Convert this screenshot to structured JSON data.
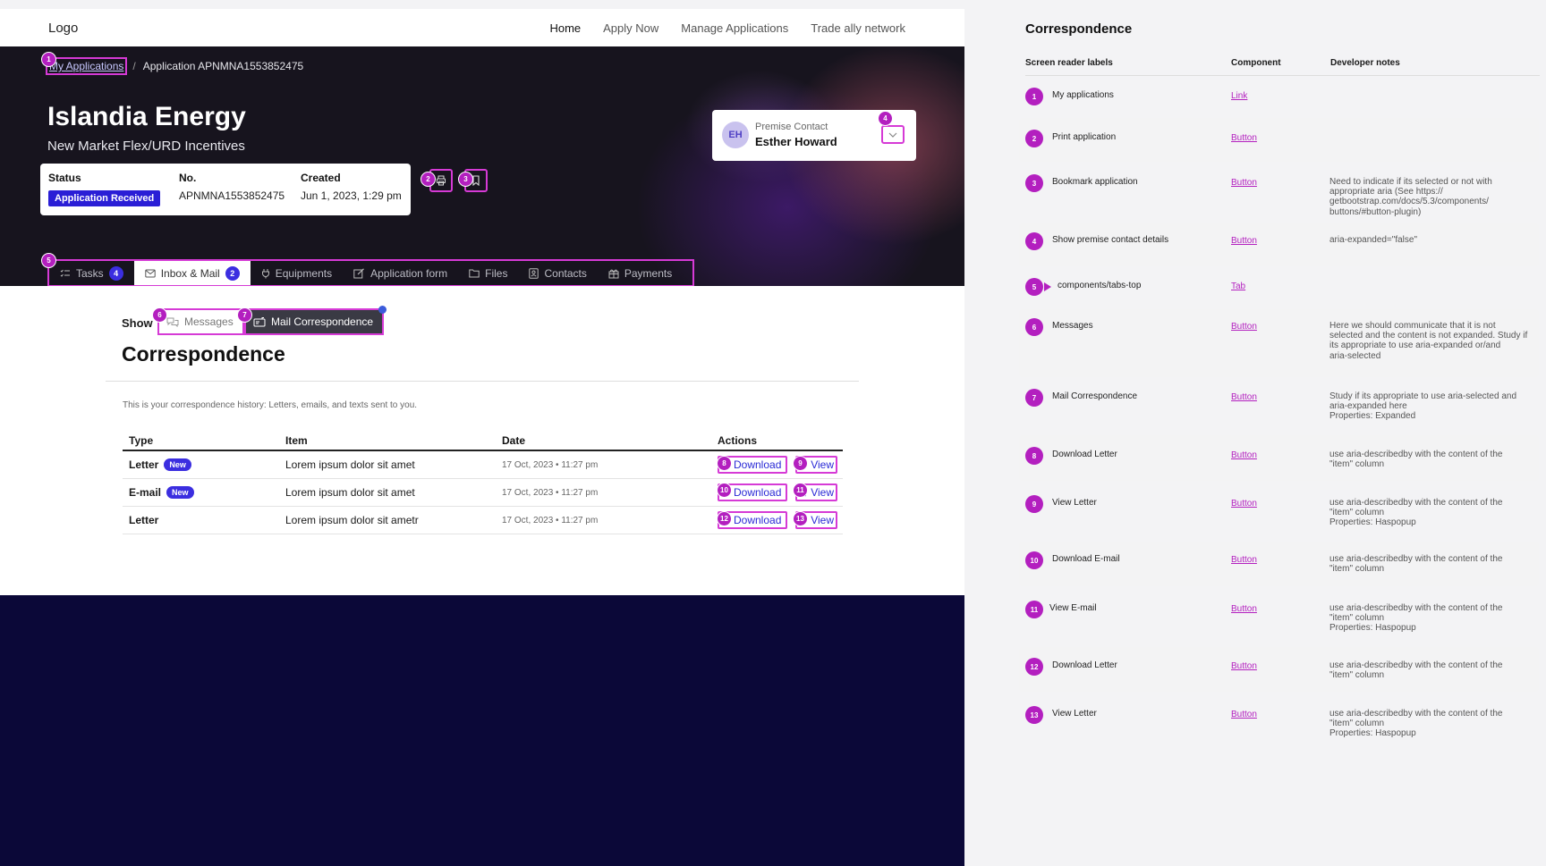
{
  "nav": {
    "logo": "Logo",
    "links": [
      "Home",
      "Apply Now",
      "Manage Applications",
      "Trade ally network"
    ]
  },
  "breadcrumb": {
    "link": "My Applications",
    "separator": "/",
    "current": "Application APNMNA1553852475"
  },
  "hero": {
    "title": "Islandia Energy",
    "subtitle": "New Market Flex/URD Incentives"
  },
  "status_card": {
    "status_label": "Status",
    "status_value": "Application Received",
    "no_label": "No.",
    "no_value": "APNMNA1553852475",
    "created_label": "Created",
    "created_value": "Jun 1, 2023, 1:29 pm"
  },
  "contact": {
    "initials": "EH",
    "label": "Premise Contact",
    "name": "Esther Howard"
  },
  "tabs": [
    {
      "label": "Tasks",
      "count": "4"
    },
    {
      "label": "Inbox & Mail",
      "count": "2"
    },
    {
      "label": "Equipments"
    },
    {
      "label": "Application form"
    },
    {
      "label": "Files"
    },
    {
      "label": "Contacts"
    },
    {
      "label": "Payments"
    }
  ],
  "content": {
    "show_label": "Show",
    "toggle_messages": "Messages",
    "toggle_mail": "Mail Correspondence",
    "title": "Correspondence",
    "description": "This is your correspondence history: Letters, emails, and texts sent to you.",
    "table": {
      "headers": [
        "Type",
        "Item",
        "Date",
        "Actions"
      ],
      "rows": [
        {
          "type": "Letter",
          "badge": "New",
          "item": "Lorem ipsum dolor sit amet",
          "date": "17 Oct, 2023 • 11:27 pm",
          "download": "Download",
          "view": "View"
        },
        {
          "type": "E-mail",
          "badge": "New",
          "item": "Lorem ipsum dolor sit amet",
          "date": "17 Oct, 2023 • 11:27 pm",
          "download": "Download",
          "view": "View"
        },
        {
          "type": "Letter",
          "item": "Lorem ipsum dolor sit ametr",
          "date": "17 Oct, 2023 • 11:27 pm",
          "download": "Download",
          "view": "View"
        }
      ]
    }
  },
  "markers": [
    "1",
    "2",
    "3",
    "4",
    "5",
    "6",
    "7",
    "8",
    "9",
    "10",
    "11",
    "12",
    "13"
  ],
  "panel": {
    "title": "Correspondence",
    "headers": [
      "Screen reader labels",
      "Component",
      "Developer notes"
    ],
    "rows": [
      {
        "n": "1",
        "label": "My applications",
        "component": "Link",
        "note": ""
      },
      {
        "n": "2",
        "label": "Print application",
        "component": "Button",
        "note": ""
      },
      {
        "n": "3",
        "label": "Bookmark application",
        "component": "Button",
        "note": "Need to indicate if its selected or not with\n appropriate aria (See https://\ngetbootstrap.com/docs/5.3/components/\nbuttons/#button-plugin)"
      },
      {
        "n": "4",
        "label": "Show premise contact details",
        "component": "Button",
        "note": "aria-expanded=\"false\""
      },
      {
        "n": "5",
        "label": "components/tabs-top",
        "component": "Tab",
        "note": ""
      },
      {
        "n": "6",
        "label": "Messages",
        "component": "Button",
        "note": "Here we should communicate that it is not\nselected and the content is not expanded. Study if\nits appropriate to use aria-expanded or/and\naria-selected"
      },
      {
        "n": "7",
        "label": "Mail Correspondence",
        "component": "Button",
        "note": "Study if its appropriate to use aria-selected and\naria-expanded here\nProperties: Expanded"
      },
      {
        "n": "8",
        "label": "Download Letter",
        "component": "Button",
        "note": "use aria-describedby with the content of the\n\"item\" column"
      },
      {
        "n": "9",
        "label": "View Letter",
        "component": "Button",
        "note": "use aria-describedby with the content of the\n\"item\" column\nProperties: Haspopup"
      },
      {
        "n": "10",
        "label": "Download E-mail",
        "component": "Button",
        "note": "use aria-describedby with the content of the\n\"item\" column"
      },
      {
        "n": "11",
        "label": "View E-mail",
        "component": "Button",
        "note": "use aria-describedby with the content of the\n\"item\" column\nProperties: Haspopup"
      },
      {
        "n": "12",
        "label": "Download Letter",
        "component": "Button",
        "note": "use aria-describedby with the content of the\n\"item\" column"
      },
      {
        "n": "13",
        "label": "View Letter",
        "component": "Button",
        "note": "use aria-describedby with the content of the\n\"item\" column\nProperties: Haspopup"
      }
    ]
  },
  "colors": {
    "accent": "#3b2ee0",
    "annotation": "#b31fbf",
    "outline": "#d63ad6",
    "hero_bg": "#17141e",
    "footer_bg": "#0b0838"
  }
}
